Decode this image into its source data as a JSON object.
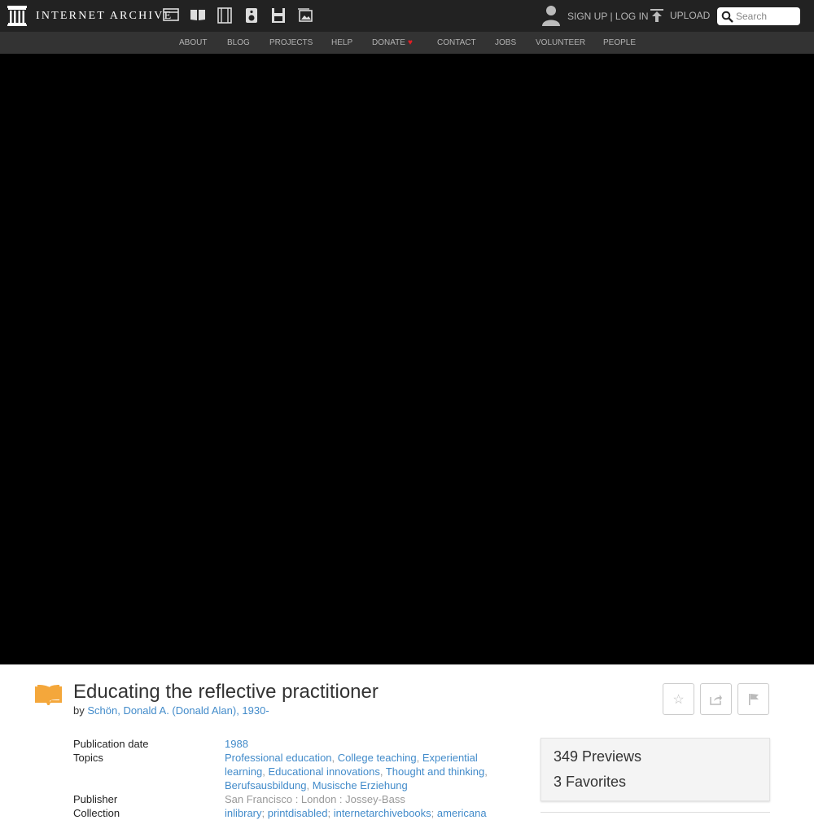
{
  "header": {
    "logo_text": "INTERNET ARCHIVE",
    "media_icons": [
      "web-icon",
      "texts-icon",
      "video-icon",
      "audio-icon",
      "software-icon",
      "images-icon"
    ],
    "auth_label": "SIGN UP | LOG IN",
    "upload_label": "UPLOAD",
    "search_placeholder": "Search"
  },
  "subnav": [
    "ABOUT",
    "BLOG",
    "PROJECTS",
    "HELP",
    "DONATE",
    "CONTACT",
    "JOBS",
    "VOLUNTEER",
    "PEOPLE"
  ],
  "item": {
    "title": "Educating the reflective practitioner",
    "by_label": "by",
    "author": "Schön, Donald A. (Donald Alan), 1930-",
    "publication_date_label": "Publication date",
    "publication_date": "1988",
    "topics_label": "Topics",
    "topics": [
      "Professional education",
      "College teaching",
      "Experiential learning",
      "Educational innovations",
      "Thought and thinking",
      "Berufsausbildung",
      "Musische Erziehung"
    ],
    "publisher_label": "Publisher",
    "publisher": "San Francisco : London : Jossey-Bass",
    "collection_label": "Collection",
    "collections": [
      "inlibrary",
      "printdisabled",
      "internetarchivebooks",
      "americana"
    ]
  },
  "stats": {
    "previews": "349 Previews",
    "favorites": "3 Favorites"
  },
  "colors": {
    "accent": "#428bca",
    "icon_orange": "#f4a73b",
    "nav_bg": "#222222",
    "subnav_bg": "#333333"
  }
}
